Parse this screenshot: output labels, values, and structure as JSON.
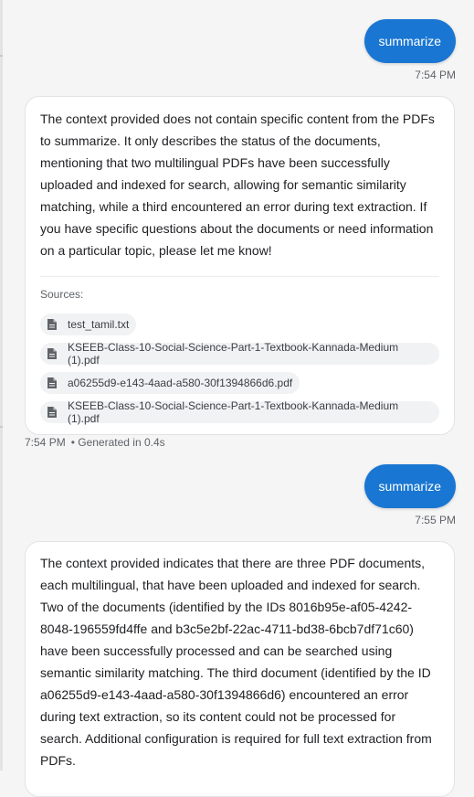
{
  "messages": {
    "user_1": {
      "text": "summarize",
      "time": "7:54 PM"
    },
    "bot_1": {
      "text": "The context provided does not contain specific content from the PDFs to summarize. It only describes the status of the documents, mentioning that two multilingual PDFs have been successfully uploaded and indexed for search, allowing for semantic similarity matching, while a third encountered an error during text extraction. If you have specific questions about the documents or need information on a particular topic, please let me know!",
      "sources_label": "Sources:",
      "sources": [
        "test_tamil.txt",
        "KSEEB-Class-10-Social-Science-Part-1-Textbook-Kannada-Medium (1).pdf",
        "a06255d9-e143-4aad-a580-30f1394866d6.pdf",
        "KSEEB-Class-10-Social-Science-Part-1-Textbook-Kannada-Medium (1).pdf"
      ],
      "time": "7:54 PM",
      "generated": "• Generated in 0.4s"
    },
    "user_2": {
      "text": "summarize",
      "time": "7:55 PM"
    },
    "bot_2": {
      "text": "The context provided indicates that there are three PDF documents, each multilingual, that have been uploaded and indexed for search. Two of the documents (identified by the IDs 8016b95e-af05-4242-8048-196559fd4ffe and b3c5e2bf-22ac-4711-bd38-6bcb7df71c60) have been successfully processed and can be searched using semantic similarity matching. The third document (identified by the ID a06255d9-e143-4aad-a580-30f1394866d6) encountered an error during text extraction, so its content could not be processed for search. Additional configuration is required for full text extraction from PDFs."
    }
  },
  "colors": {
    "accent": "#1976d2",
    "card": "#ffffff",
    "background": "#f5f5f6"
  },
  "icons": {
    "source_chip": "file-document-icon"
  }
}
